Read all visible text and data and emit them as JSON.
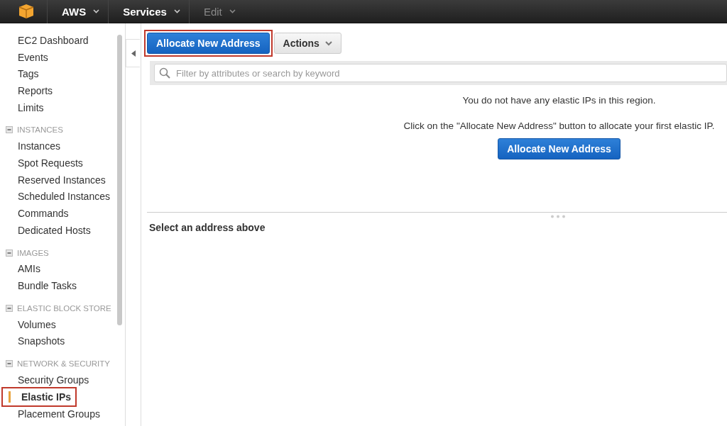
{
  "topbar": {
    "items": [
      {
        "label": "AWS",
        "disabled": false
      },
      {
        "label": "Services",
        "disabled": false
      },
      {
        "label": "Edit",
        "disabled": true
      }
    ]
  },
  "sidebar": {
    "groups": [
      {
        "items": [
          {
            "label": "EC2 Dashboard",
            "selected": false
          },
          {
            "label": "Events",
            "selected": false
          },
          {
            "label": "Tags",
            "selected": false
          },
          {
            "label": "Reports",
            "selected": false
          },
          {
            "label": "Limits",
            "selected": false
          }
        ]
      },
      {
        "title": "INSTANCES",
        "items": [
          {
            "label": "Instances",
            "selected": false
          },
          {
            "label": "Spot Requests",
            "selected": false
          },
          {
            "label": "Reserved Instances",
            "selected": false
          },
          {
            "label": "Scheduled Instances",
            "selected": false
          },
          {
            "label": "Commands",
            "selected": false
          },
          {
            "label": "Dedicated Hosts",
            "selected": false
          }
        ]
      },
      {
        "title": "IMAGES",
        "items": [
          {
            "label": "AMIs",
            "selected": false
          },
          {
            "label": "Bundle Tasks",
            "selected": false
          }
        ]
      },
      {
        "title": "ELASTIC BLOCK STORE",
        "items": [
          {
            "label": "Volumes",
            "selected": false
          },
          {
            "label": "Snapshots",
            "selected": false
          }
        ]
      },
      {
        "title": "NETWORK & SECURITY",
        "items": [
          {
            "label": "Security Groups",
            "selected": false
          },
          {
            "label": "Elastic IPs",
            "selected": true,
            "highlighted": true
          },
          {
            "label": "Placement Groups",
            "selected": false
          }
        ]
      }
    ]
  },
  "toolbar": {
    "buttons": [
      {
        "label": "Allocate New Address",
        "kind": "primary",
        "highlighted": true
      },
      {
        "label": "Actions",
        "kind": "dropdown",
        "highlighted": false
      }
    ]
  },
  "search": {
    "placeholder": "Filter by attributes or search by keyword"
  },
  "empty_state": {
    "message": "You do not have any elastic IPs in this region.",
    "hint": "Click on the \"Allocate New Address\" button to allocate your first elastic IP.",
    "button": "Allocate New Address"
  },
  "details": {
    "title": "Select an address above"
  }
}
